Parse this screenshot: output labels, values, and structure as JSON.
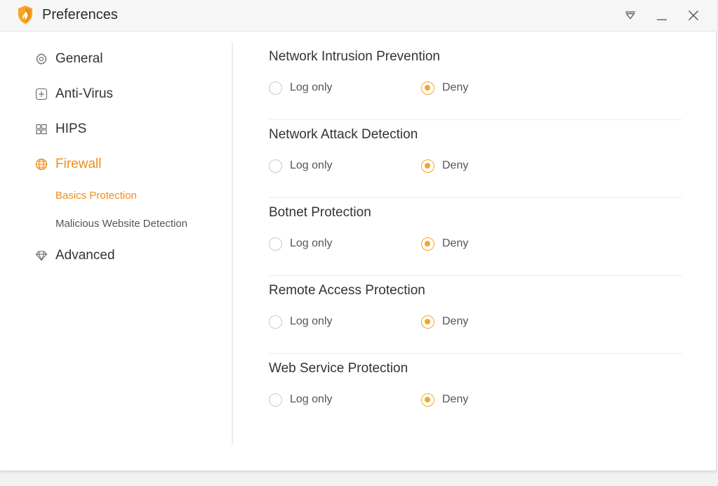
{
  "window": {
    "title": "Preferences",
    "controls": [
      "dropdown-icon",
      "minimize-icon",
      "close-icon"
    ]
  },
  "sidebar": {
    "items": [
      {
        "label": "General",
        "icon": "gear-icon",
        "active": false
      },
      {
        "label": "Anti-Virus",
        "icon": "plus-box-icon",
        "active": false
      },
      {
        "label": "HIPS",
        "icon": "windows-icon",
        "active": false
      },
      {
        "label": "Firewall",
        "icon": "globe-icon",
        "active": true
      },
      {
        "label": "Advanced",
        "icon": "diamond-icon",
        "active": false
      }
    ],
    "firewall_subitems": [
      {
        "label": "Basics Protection",
        "active": true
      },
      {
        "label": "Malicious Website Detection",
        "active": false
      }
    ]
  },
  "main": {
    "option_labels": {
      "log_only": "Log only",
      "deny": "Deny"
    },
    "sections": [
      {
        "title": "Network Intrusion Prevention",
        "selected": "Deny"
      },
      {
        "title": "Network Attack Detection",
        "selected": "Deny"
      },
      {
        "title": "Botnet Protection",
        "selected": "Deny"
      },
      {
        "title": "Remote Access Protection",
        "selected": "Deny"
      },
      {
        "title": "Web Service Protection",
        "selected": "Deny"
      }
    ]
  },
  "colors": {
    "accent": "#f08c1a",
    "radio_selected": "#f5a623",
    "text": "#333333"
  }
}
